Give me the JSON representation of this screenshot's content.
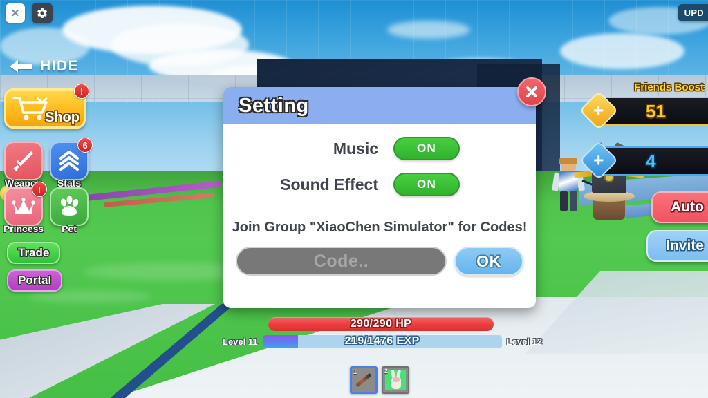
{
  "window": {
    "top_left": {
      "close_icon": "close-x-icon",
      "gear_icon": "gear-icon"
    },
    "top_right": {
      "update_badge": "UPD"
    }
  },
  "hud": {
    "hide_button": {
      "label": "HIDE",
      "arrow_icon": "arrow-left-icon"
    },
    "shop_button": {
      "label": "Shop",
      "icon": "shopping-cart-icon",
      "badge": "!"
    },
    "icon_buttons": [
      {
        "label": "Weapon",
        "icon": "sword-icon",
        "badge": "",
        "color": "#e2545f"
      },
      {
        "label": "Stats",
        "icon": "chevrons-up-icon",
        "badge": "6",
        "color": "#2f6ed8"
      },
      {
        "label": "Princess",
        "icon": "crown-icon",
        "badge": "!",
        "color": "#e8647a"
      },
      {
        "label": "Pet",
        "icon": "paw-print-icon",
        "badge": "",
        "color": "#3aa83b"
      }
    ],
    "pill_buttons": [
      {
        "label": "Trade",
        "color": "#33c23a"
      },
      {
        "label": "Portal",
        "color": "#b23fc0"
      }
    ],
    "right_panel": {
      "friends_boost_label": "Friends Boost",
      "currencies": [
        {
          "type": "gold",
          "icon": "plus-icon",
          "value": "51"
        },
        {
          "type": "gem",
          "icon": "plus-icon",
          "value": "4"
        }
      ],
      "auto_button": "Auto",
      "invite_button": "Invite"
    },
    "status_bars": {
      "hp_text": "290/290 HP",
      "hp_percent": 100,
      "exp_text": "219/1476 EXP",
      "exp_percent": 14.8,
      "level_current": "Level 11",
      "level_next": "Level 12"
    },
    "hotbar": [
      {
        "slot": "1",
        "item": "sword-item",
        "selected": true
      },
      {
        "slot": "2",
        "item": "bunny-pet-item",
        "selected": false
      }
    ]
  },
  "settings_dialog": {
    "title": "Setting",
    "close_icon": "close-x-icon",
    "rows": [
      {
        "label": "Music",
        "toggle": "ON"
      },
      {
        "label": "Sound Effect",
        "toggle": "ON"
      }
    ],
    "join_text": "Join Group \"XiaoChen Simulator\" for Codes!",
    "code_input_placeholder": "Code..",
    "code_input_value": "",
    "ok_button": "OK"
  },
  "theme": {
    "header_blue": "#8aaef0",
    "toggle_green": "#36bd33",
    "close_red": "#e0434a",
    "ok_blue": "#66b4ec",
    "gold": "#ffc82e"
  }
}
